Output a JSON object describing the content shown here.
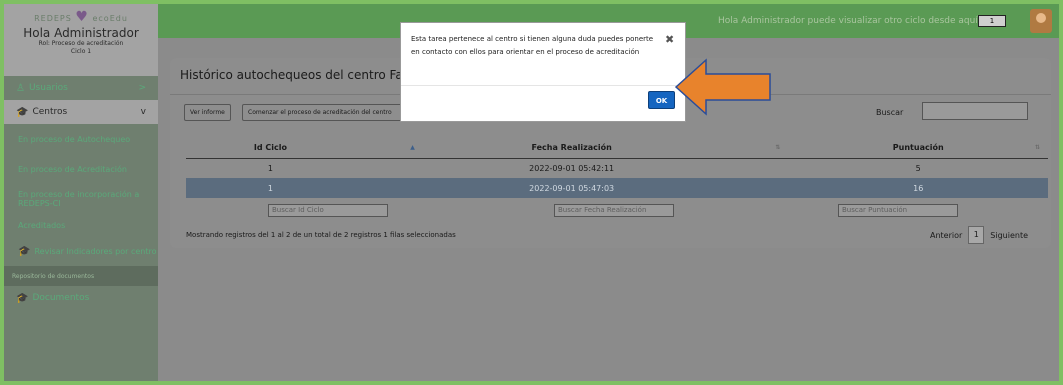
{
  "sidebar": {
    "logo": {
      "text_left": "REDEPS",
      "text_right": "ecoEdu"
    },
    "greeting": "Hola Administrador",
    "role": "Rol: Proceso de acreditación",
    "cycle": "Ciclo 1",
    "items": [
      {
        "label": "Usuarios",
        "chevron": ">"
      },
      {
        "label": "Centros",
        "chevron": "v"
      },
      {
        "label": "En proceso de Autochequeo"
      },
      {
        "label": "En proceso de Acreditación"
      },
      {
        "label": "En proceso de incorporación a REDEPS-CI"
      },
      {
        "label": "Acreditados"
      },
      {
        "label": "Revisar Indicadores por centro"
      }
    ],
    "section": "Repositorio de documentos",
    "documents": "Documentos"
  },
  "topbar": {
    "message": "Hola Administrador puede visualizar otro ciclo desde aquí:",
    "cycle_select": "1"
  },
  "main": {
    "title": "Histórico autochequeos del centro Fac",
    "buttons": {
      "report": "Ver informe",
      "start": "Comenzar el proceso de acreditación del centro"
    },
    "search_label": "Buscar",
    "table": {
      "columns": [
        "Id Ciclo",
        "Fecha Realización",
        "Puntuación"
      ],
      "rows": [
        [
          "1",
          "2022-09-01 05:42:11",
          "5"
        ],
        [
          "1",
          "2022-09-01 05:47:03",
          "16"
        ]
      ],
      "filters": [
        "Buscar Id Ciclo",
        "Buscar Fecha Realización",
        "Buscar Puntuación"
      ]
    },
    "info": "Mostrando registros del 1 al 2 de un total de 2 registros   1 filas seleccionadas",
    "pager": {
      "prev": "Anterior",
      "page": "1",
      "next": "Siguiente"
    }
  },
  "modal": {
    "message": "Esta tarea pertenece al centro si tienen alguna duda puedes ponerte en contacto con ellos para orientar en el proceso de acreditación",
    "close": "✖",
    "ok": "OK"
  },
  "colors": {
    "accent": "#5a9a54",
    "ok_button": "#1565c0",
    "arrow": "#e8832c",
    "selected_row": "#5b6c7e"
  }
}
